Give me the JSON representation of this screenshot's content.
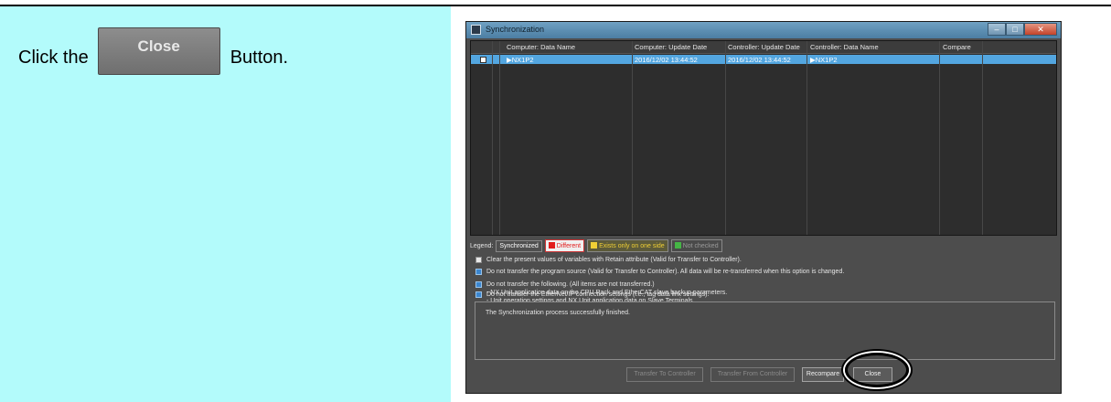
{
  "instruction": {
    "prefix": "Click the",
    "button_label": "Close",
    "suffix": "Button."
  },
  "dialog": {
    "title": "Synchronization",
    "columns": [
      "Computer: Data Name",
      "Computer: Update Date",
      "Controller: Update Date",
      "Controller: Data Name",
      "Compare"
    ],
    "rows": [
      {
        "computer_name": "▶NX1P2",
        "computer_date": "2016/12/02 13:44:52",
        "controller_date": "2016/12/02 13:44:52",
        "controller_name": "▶NX1P2",
        "compare": ""
      }
    ],
    "legend": {
      "label": "Legend:",
      "synchronized": "Synchronized",
      "different": "Different",
      "exists_one_side": "Exists only on one side",
      "not_checked": "Not checked"
    },
    "options": [
      {
        "checked": false,
        "text": "Clear the present values of variables with Retain attribute (Valid for Transfer to Controller)."
      },
      {
        "checked": true,
        "text": "Do not transfer the program source (Valid for Transfer to Controller). All data will be re-transferred when this option is changed."
      },
      {
        "checked": true,
        "text": "Do not transfer the following. (All items are not transferred.)",
        "sub": [
          "- NX Unit application data on the CPU Rack and EtherCAT slave backup parameters.",
          "- Unit operation settings and NX Unit application data on Slave Terminals."
        ]
      },
      {
        "checked": true,
        "text": "Do not transfer the EtherNet/IP connection settings (i.e., tag data link settings)."
      }
    ],
    "message": "The Synchronization process successfully finished.",
    "buttons": {
      "transfer_to": "Transfer To Controller",
      "transfer_from": "Transfer From Controller",
      "recompare": "Recompare",
      "close": "Close"
    }
  },
  "colors": {
    "instruction_bg": "#b3fbfb",
    "selected_row": "#53a6e0",
    "dialog_bg": "#4d4d4d"
  }
}
